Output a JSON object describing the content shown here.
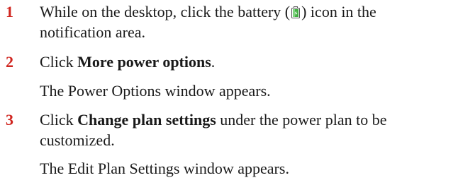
{
  "steps": [
    {
      "number": "1",
      "text_before_icon": "While on the desktop, click the battery (",
      "icon": "battery-icon",
      "text_after_icon": ") icon in the notification area."
    },
    {
      "number": "2",
      "text_before": "Click ",
      "bold": "More power options",
      "text_after": ".",
      "note": "The Power Options window appears."
    },
    {
      "number": "3",
      "text_before": "Click ",
      "bold": "Change plan settings",
      "text_after": " under the power plan to be customized.",
      "note": "The Edit Plan Settings window appears."
    }
  ],
  "colors": {
    "step_number": "#d0251f",
    "text": "#1a1a1a",
    "battery_green": "#3fae3f"
  }
}
